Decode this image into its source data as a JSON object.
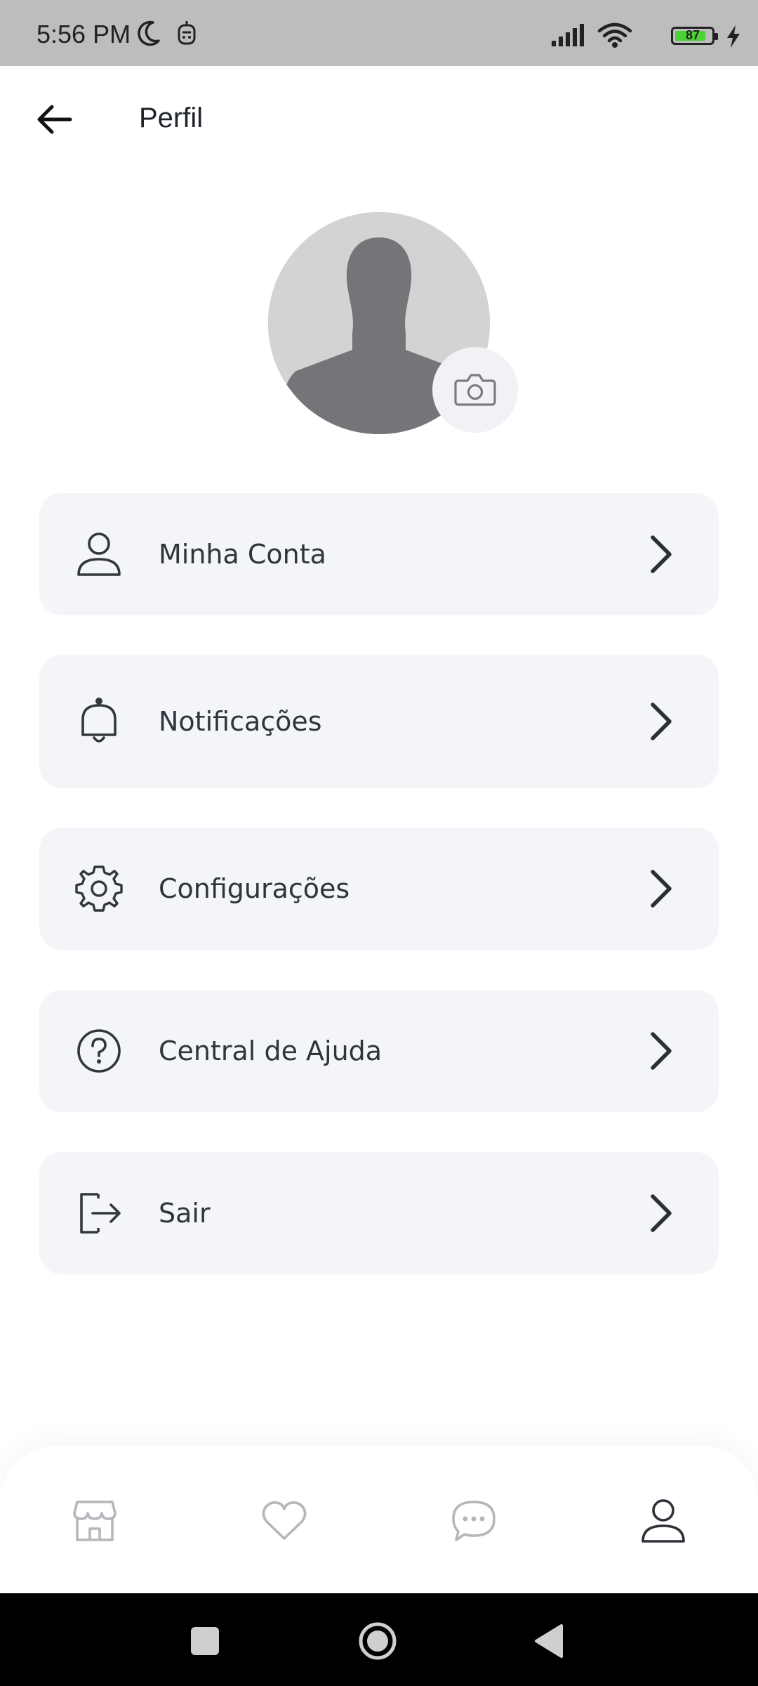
{
  "status_bar": {
    "time": "5:56 PM",
    "battery": "87",
    "battery_level": 0.87,
    "icons": [
      "moon-icon",
      "notification-icon",
      "signal-icon",
      "wifi-icon",
      "battery-icon",
      "charging-icon"
    ]
  },
  "header": {
    "title": "Perfil",
    "back_icon": "arrow-left-icon"
  },
  "profile": {
    "avatar_icon": "default-avatar-icon",
    "camera_icon": "camera-icon"
  },
  "menu": {
    "items": [
      {
        "label": "Minha Conta",
        "icon": "user-icon"
      },
      {
        "label": "Notificações",
        "icon": "bell-icon"
      },
      {
        "label": "Configurações",
        "icon": "gear-icon"
      },
      {
        "label": "Central de Ajuda",
        "icon": "help-icon"
      },
      {
        "label": "Sair",
        "icon": "logout-icon"
      }
    ],
    "chevron_icon": "chevron-right-icon"
  },
  "bottom_nav": {
    "items": [
      "store-icon",
      "heart-icon",
      "chat-icon",
      "user-icon"
    ],
    "active": "user-icon"
  },
  "system_nav": {
    "items": [
      "recent-apps-icon",
      "home-icon",
      "back-icon"
    ]
  },
  "colors": {
    "status_bar_bg": "#bdbdbd",
    "card_bg": "#f4f5f9",
    "text": "#30343c",
    "inactive_icon": "#b4b6bb",
    "battery_fill": "#4cd137"
  }
}
